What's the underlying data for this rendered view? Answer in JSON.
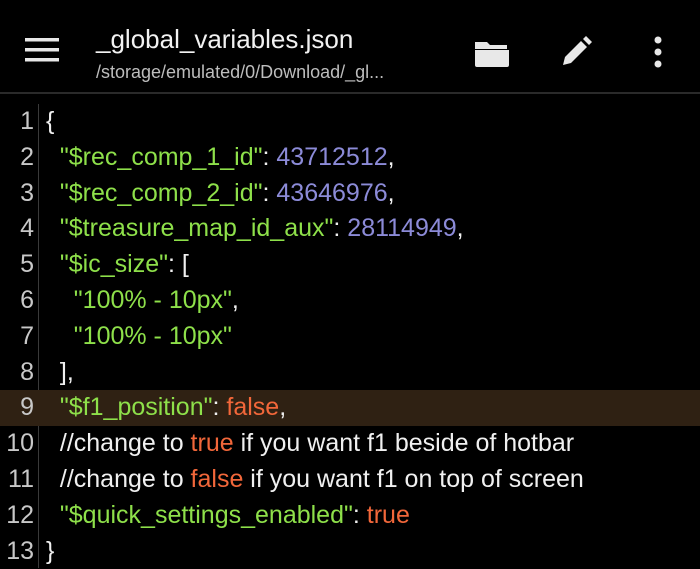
{
  "toolbar": {
    "title": "_global_variables.json",
    "path": "/storage/emulated/0/Download/_gl...",
    "icons": {
      "menu": "hamburger-menu-icon",
      "folder": "folder-open-icon",
      "edit": "pencil-icon",
      "more": "more-vertical-icon"
    }
  },
  "colors": {
    "background": "#000000",
    "key_string": "#8ee04a",
    "number": "#8c8bd8",
    "boolean": "#f2673a",
    "highlight_line": "#2f2113",
    "plain_text": "#f0f0f0"
  },
  "editor": {
    "highlighted_line": 9,
    "lines": [
      {
        "num": "1",
        "tokens": [
          {
            "t": "{",
            "c": "p"
          }
        ]
      },
      {
        "num": "2",
        "tokens": [
          {
            "t": "  ",
            "c": "p"
          },
          {
            "t": "\"$rec_comp_1_id\"",
            "c": "k"
          },
          {
            "t": ": ",
            "c": "p"
          },
          {
            "t": "43712512",
            "c": "n"
          },
          {
            "t": ",",
            "c": "p"
          }
        ]
      },
      {
        "num": "3",
        "tokens": [
          {
            "t": "  ",
            "c": "p"
          },
          {
            "t": "\"$rec_comp_2_id\"",
            "c": "k"
          },
          {
            "t": ": ",
            "c": "p"
          },
          {
            "t": "43646976",
            "c": "n"
          },
          {
            "t": ",",
            "c": "p"
          }
        ]
      },
      {
        "num": "4",
        "tokens": [
          {
            "t": "  ",
            "c": "p"
          },
          {
            "t": "\"$treasure_map_id_aux\"",
            "c": "k"
          },
          {
            "t": ": ",
            "c": "p"
          },
          {
            "t": "28114949",
            "c": "n"
          },
          {
            "t": ",",
            "c": "p"
          }
        ]
      },
      {
        "num": "5",
        "tokens": [
          {
            "t": "  ",
            "c": "p"
          },
          {
            "t": "\"$ic_size\"",
            "c": "k"
          },
          {
            "t": ": [",
            "c": "p"
          }
        ]
      },
      {
        "num": "6",
        "tokens": [
          {
            "t": "    ",
            "c": "p"
          },
          {
            "t": "\"100% - 10px\"",
            "c": "s"
          },
          {
            "t": ",",
            "c": "p"
          }
        ]
      },
      {
        "num": "7",
        "tokens": [
          {
            "t": "    ",
            "c": "p"
          },
          {
            "t": "\"100% - 10px\"",
            "c": "s"
          }
        ]
      },
      {
        "num": "8",
        "tokens": [
          {
            "t": "  ],",
            "c": "p"
          }
        ]
      },
      {
        "num": "9",
        "tokens": [
          {
            "t": "  ",
            "c": "p"
          },
          {
            "t": "\"$f1_position\"",
            "c": "k"
          },
          {
            "t": ": ",
            "c": "p"
          },
          {
            "t": "false",
            "c": "b"
          },
          {
            "t": ",",
            "c": "p"
          }
        ]
      },
      {
        "num": "10",
        "tokens": [
          {
            "t": "  //change to ",
            "c": "c"
          },
          {
            "t": "true",
            "c": "b"
          },
          {
            "t": " if you want f1 beside of hotbar",
            "c": "c"
          }
        ]
      },
      {
        "num": "11",
        "tokens": [
          {
            "t": "  //change to ",
            "c": "c"
          },
          {
            "t": "false",
            "c": "b"
          },
          {
            "t": " if you want f1 on top of screen",
            "c": "c"
          }
        ]
      },
      {
        "num": "12",
        "tokens": [
          {
            "t": "  ",
            "c": "p"
          },
          {
            "t": "\"$quick_settings_enabled\"",
            "c": "k"
          },
          {
            "t": ": ",
            "c": "p"
          },
          {
            "t": "true",
            "c": "b"
          }
        ]
      },
      {
        "num": "13",
        "tokens": [
          {
            "t": "}",
            "c": "p"
          }
        ]
      }
    ]
  }
}
